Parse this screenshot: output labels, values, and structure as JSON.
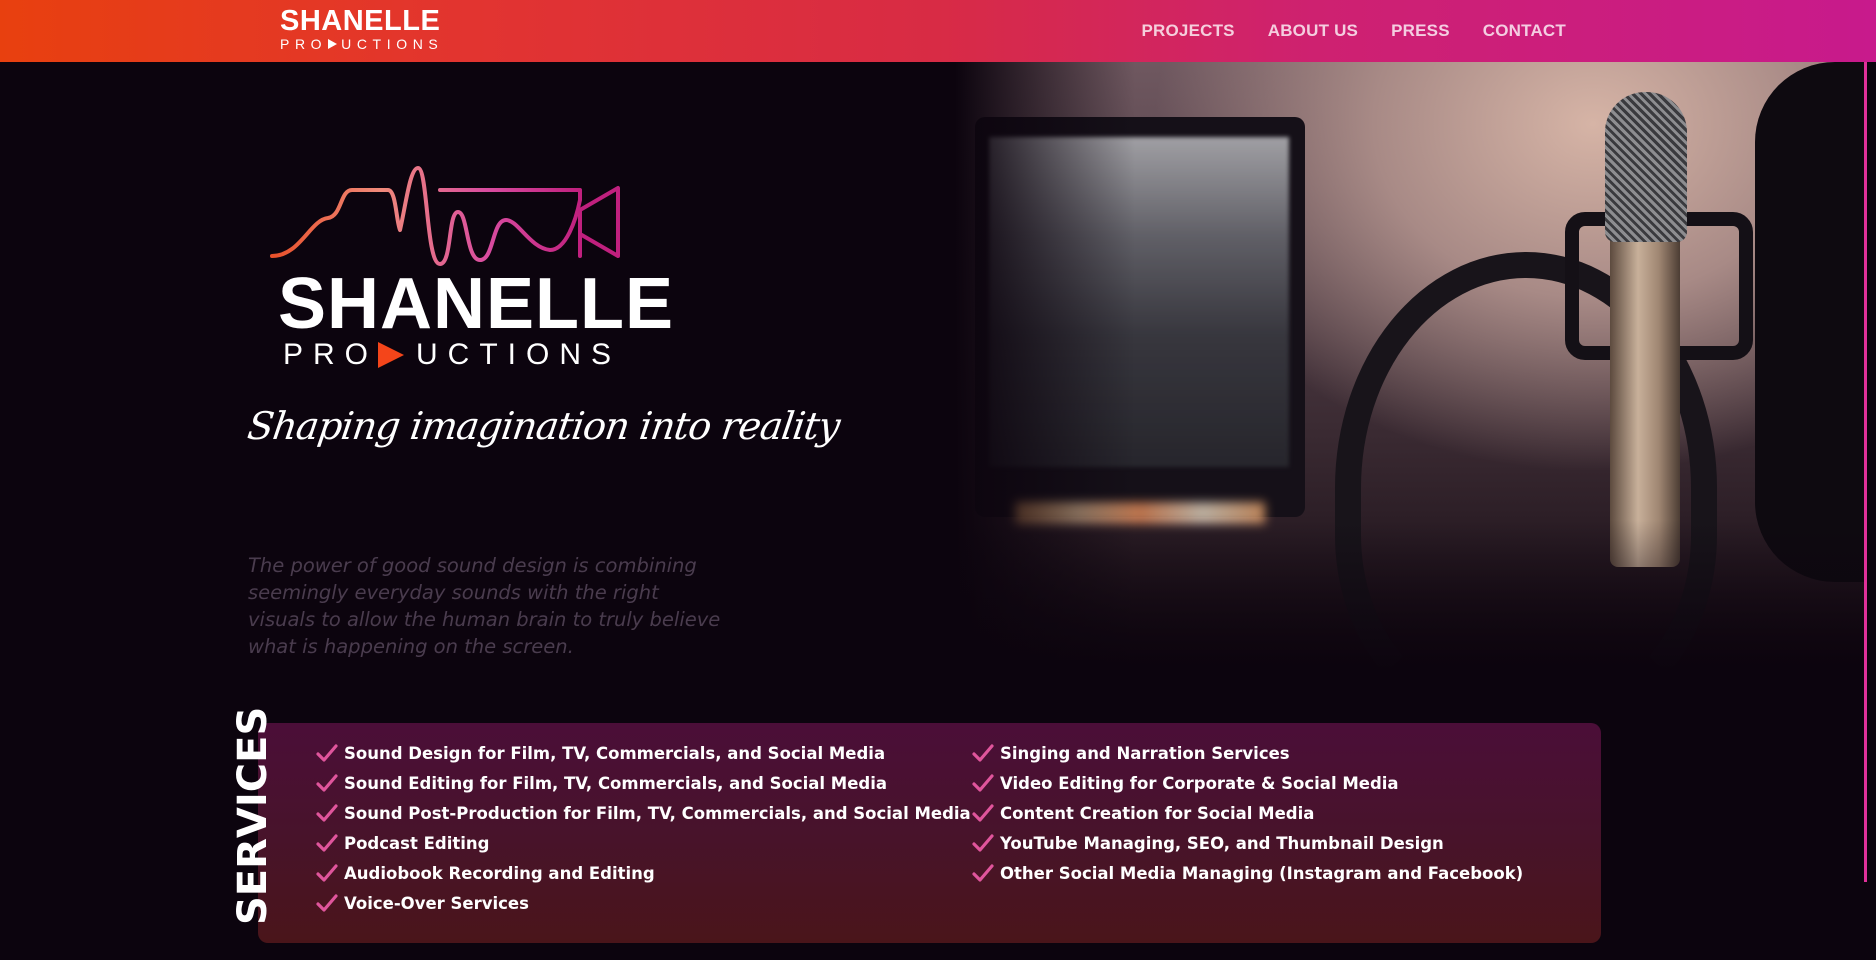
{
  "header": {
    "logo_main": "SHANELLE",
    "logo_sub_left": "PRO",
    "logo_sub_right": "UCTIONS",
    "nav": [
      {
        "label": "PROJECTS"
      },
      {
        "label": "ABOUT US"
      },
      {
        "label": "PRESS"
      },
      {
        "label": "CONTACT"
      }
    ]
  },
  "hero": {
    "title": "SHANELLE",
    "sub_left": "PRO",
    "sub_right": "UCTIONS",
    "tagline": "Shaping imagination into reality",
    "quote": "The power of good sound design is combining seemingly everyday sounds with the right visuals to allow the human brain to truly believe what is happening on the screen."
  },
  "services": {
    "label": "SERVICES",
    "left": [
      "Sound Design for Film, TV, Commercials, and Social Media",
      "Sound Editing for Film, TV, Commercials, and Social Media",
      "Sound Post-Production for Film, TV, Commercials, and Social Media",
      "Podcast Editing",
      "Audiobook Recording and Editing",
      "Voice-Over Services"
    ],
    "right": [
      "Singing and Narration Services",
      "Video Editing for Corporate & Social Media",
      "Content Creation for Social Media",
      "YouTube Managing, SEO, and Thumbnail Design",
      "Other Social Media Managing (Instagram and Facebook)"
    ]
  },
  "colors": {
    "header_start": "#e8400f",
    "header_end": "#c81a8c",
    "accent_orange": "#f4451a",
    "check_pink": "#e0559c",
    "background": "#0c040e"
  }
}
